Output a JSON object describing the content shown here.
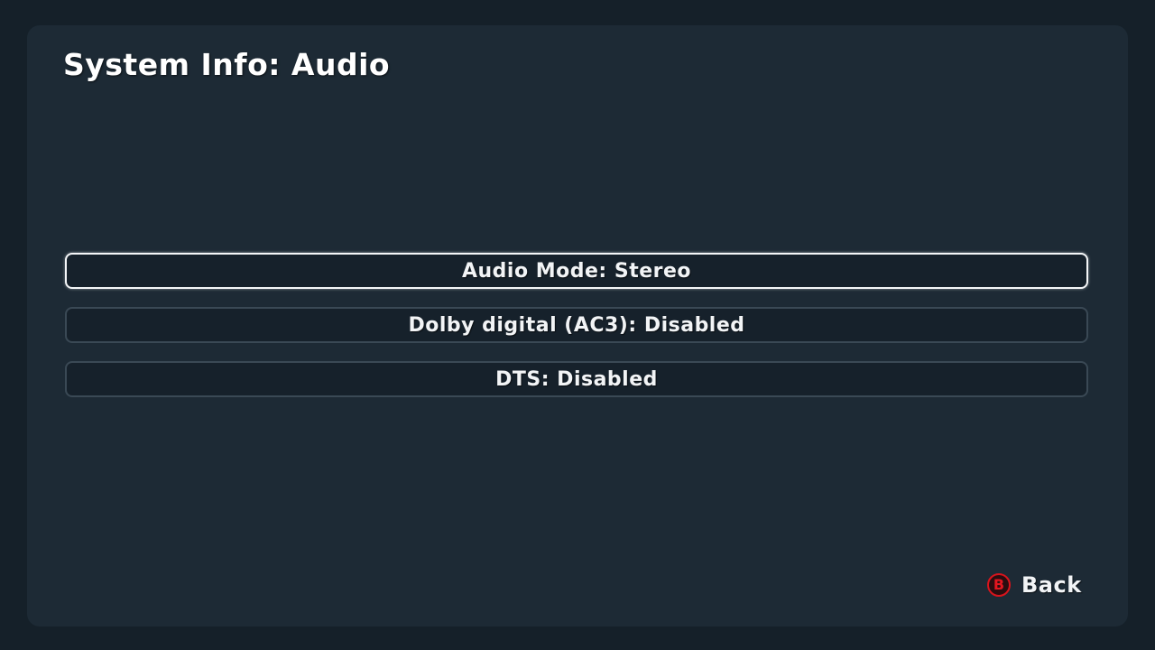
{
  "title": "System Info: Audio",
  "items": [
    {
      "label": "Audio Mode: Stereo",
      "selected": true
    },
    {
      "label": "Dolby digital (AC3): Disabled",
      "selected": false
    },
    {
      "label": "DTS: Disabled",
      "selected": false
    }
  ],
  "footer": {
    "button_glyph": "B",
    "back_label": "Back",
    "button_color": "#e3161f"
  },
  "colors": {
    "background": "#152029",
    "panel": "#1d2a35",
    "item_fill": "#16212b",
    "item_border": "#3a4955",
    "selected_border": "#f4f6f8",
    "text": "#f2f4f6"
  }
}
